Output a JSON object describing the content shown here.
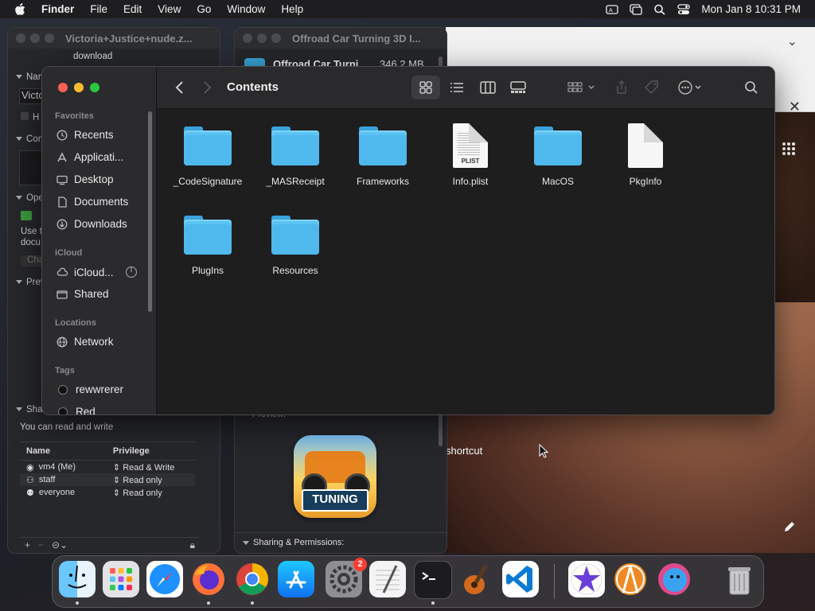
{
  "menubar": {
    "app_name": "Finder",
    "items": [
      "File",
      "Edit",
      "View",
      "Go",
      "Window",
      "Help"
    ],
    "clock": "Mon Jan 8  10:31 PM"
  },
  "background_windows": {
    "info_left": {
      "title": "Victoria+Justice+nude.z...",
      "subtitle": "download",
      "name_section": "Nam",
      "name_value": "Victo",
      "hide_ext": "H",
      "comments_section": "Com",
      "open_with_section": "Ope",
      "open_with_text_1": "Use t",
      "open_with_text_2": "docu",
      "change_all": "Cha",
      "preview_section": "Prev",
      "sharing_section": "Sha",
      "sharing_note": "You can read and write",
      "perm_headers": [
        "Name",
        "Privilege"
      ],
      "perm_rows": [
        {
          "name": "vm4 (Me)",
          "priv": "Read & Write"
        },
        {
          "name": "staff",
          "priv": "Read only"
        },
        {
          "name": "everyone",
          "priv": "Read only"
        }
      ]
    },
    "info_mid": {
      "title": "Offroad Car Turning 3D I...",
      "file_name": "Offroad Car Turni",
      "file_size": "346.2 MB",
      "preview_label": "Preview:",
      "app_icon_text": "TUNING",
      "sharing_label": "Sharing & Permissions:"
    },
    "desktop_text": "shortcut"
  },
  "finder": {
    "title": "Contents",
    "sidebar": {
      "favorites_header": "Favorites",
      "favorites": [
        "Recents",
        "Applicati...",
        "Desktop",
        "Documents",
        "Downloads"
      ],
      "icloud_header": "iCloud",
      "icloud": [
        "iCloud...",
        "Shared"
      ],
      "locations_header": "Locations",
      "locations": [
        "Network"
      ],
      "tags_header": "Tags",
      "tags": [
        {
          "name": "rewwrerer",
          "color": "#1a1a1a"
        },
        {
          "name": "Red",
          "color": "#1a1a1a"
        }
      ]
    },
    "items": [
      {
        "name": "_CodeSignature",
        "kind": "folder"
      },
      {
        "name": "_MASReceipt",
        "kind": "folder"
      },
      {
        "name": "Frameworks",
        "kind": "folder"
      },
      {
        "name": "Info.plist",
        "kind": "plist",
        "badge": "PLIST"
      },
      {
        "name": "MacOS",
        "kind": "folder"
      },
      {
        "name": "PkgInfo",
        "kind": "document"
      },
      {
        "name": "PlugIns",
        "kind": "folder"
      },
      {
        "name": "Resources",
        "kind": "folder"
      }
    ]
  },
  "dock": {
    "apps": [
      "Finder",
      "Launchpad",
      "Safari",
      "Firefox",
      "Chrome",
      "App Store",
      "System Settings",
      "TextEdit",
      "Terminal",
      "GarageBand",
      "Visual Studio Code",
      "iMovie",
      "Instruments",
      "Migration",
      "Trash"
    ],
    "settings_badge": "2"
  },
  "colors": {
    "folder": "#5ac3f3",
    "close": "#ff5f57",
    "minimize": "#febc2e",
    "zoom": "#28c840"
  }
}
